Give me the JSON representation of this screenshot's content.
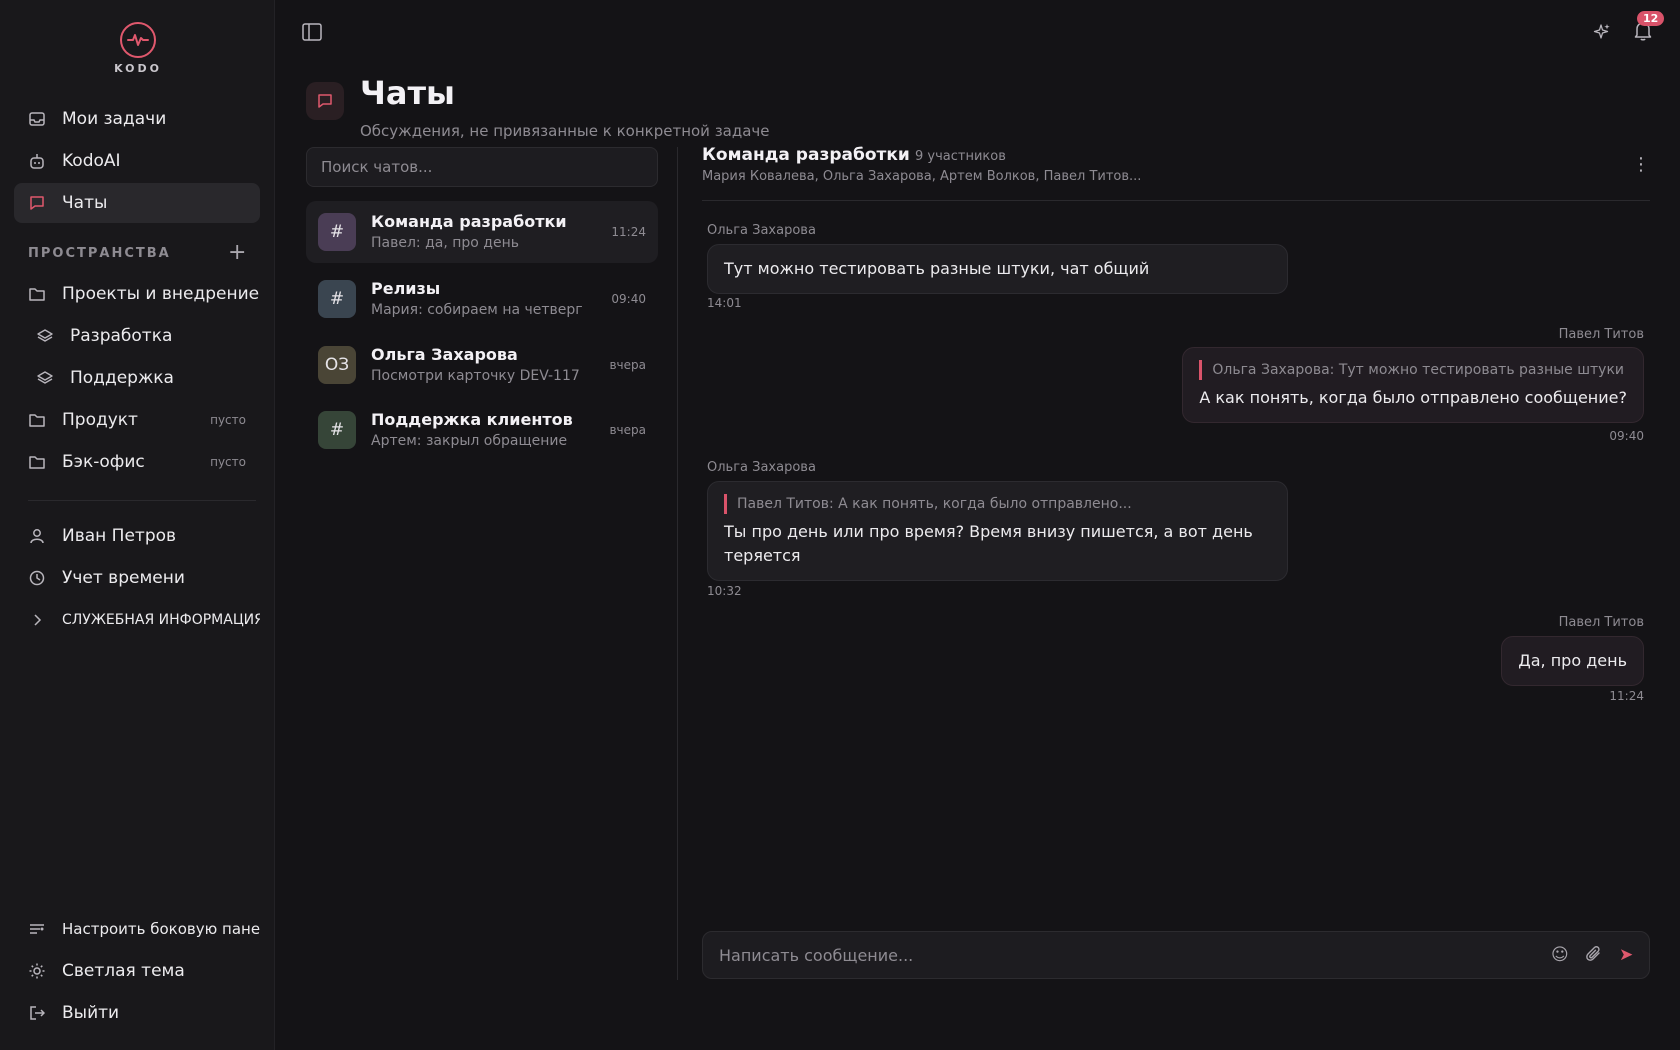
{
  "app": {
    "logo_text": "KODO",
    "notifications_count": "12"
  },
  "sidebar": {
    "nav": [
      {
        "label": "Мои задачи",
        "icon": "inbox-icon"
      },
      {
        "label": "KodoAI",
        "icon": "bot-icon"
      },
      {
        "label": "Чаты",
        "icon": "chat-icon",
        "active": true
      }
    ],
    "spaces_title": "ПРОСТРАНСТВА",
    "spaces": [
      {
        "label": "Проекты и внедрение",
        "icon": "folder-icon"
      },
      {
        "label": "Разработка",
        "icon": "layers-icon"
      },
      {
        "label": "Поддержка",
        "icon": "layers-icon"
      },
      {
        "label": "Продукт",
        "icon": "folder-icon",
        "badge": "пусто"
      },
      {
        "label": "Бэк-офис",
        "icon": "folder-icon",
        "badge": "пусто"
      }
    ],
    "user": {
      "name": "Иван Петров"
    },
    "time_tracking": "Учет времени",
    "service_info": "СЛУЖЕБНАЯ ИНФОРМАЦИЯ",
    "customize": "Настроить боковую панель",
    "theme": "Светлая тема",
    "logout": "Выйти"
  },
  "page": {
    "title": "Чаты",
    "subtitle": "Обсуждения, не привязанные к конкретной задаче"
  },
  "chat_list": {
    "search_placeholder": "Поиск чатов...",
    "items": [
      {
        "avatar": "#",
        "name": "Команда разработки",
        "preview": "Павел: да, про день",
        "time": "11:24",
        "color": "#4a3d55"
      },
      {
        "avatar": "#",
        "name": "Релизы",
        "preview": "Мария: собираем на четверг",
        "time": "09:40",
        "color": "#3a4550"
      },
      {
        "avatar": "ОЗ",
        "name": "Ольга Захарова",
        "preview": "Посмотри карточку DEV-117",
        "time": "вчера",
        "color": "#4a4536"
      },
      {
        "avatar": "#",
        "name": "Поддержка клиентов",
        "preview": "Артем: закрыл обращение",
        "time": "вчера",
        "color": "#364538"
      }
    ]
  },
  "conversation": {
    "title": "Команда разработки",
    "members_count": "9 участников",
    "members": "Мария Ковалева, Ольга Захарова, Артем Волков, Павел Титов...",
    "messages": [
      {
        "author": "Ольга Захарова",
        "text": "Тут можно тестировать разные штуки, чат общий",
        "time": "14:01"
      },
      {
        "author": "Павел Титов",
        "quote": "Ольга Захарова: Тут можно тестировать разные штуки",
        "text": "А как понять, когда было отправлено сообщение?",
        "time": "09:40"
      },
      {
        "author": "Ольга Захарова",
        "quote": "Павел Титов: А как понять, когда было отправлено...",
        "text": "Ты про день или про время? Время внизу пишется, а вот день теряется",
        "time": "10:32"
      },
      {
        "author": "Павел Титов",
        "text": "Да, про день",
        "time": "11:24"
      }
    ],
    "composer_placeholder": "Написать сообщение..."
  },
  "colors": {
    "accent": "#e0586d",
    "background": "#141316",
    "sidebar": "#19181b"
  }
}
